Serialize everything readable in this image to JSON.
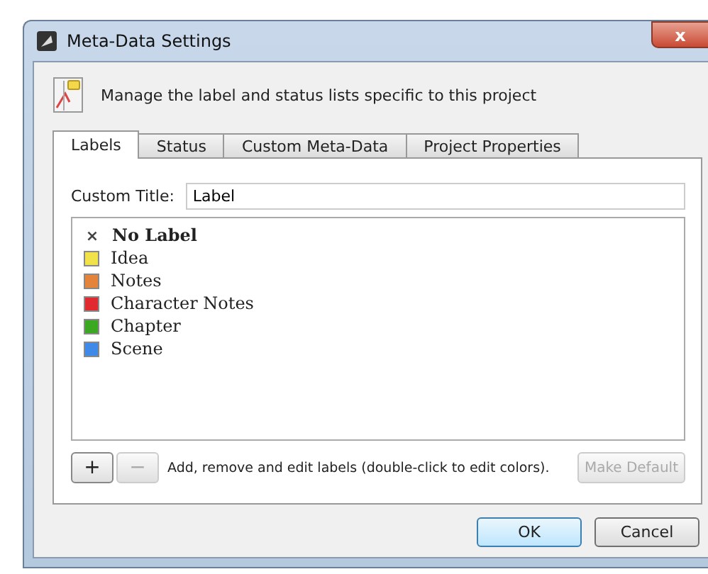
{
  "window": {
    "title": "Meta-Data Settings",
    "close": "x"
  },
  "header": {
    "text": "Manage the label and status lists specific to this project"
  },
  "tabs": [
    {
      "label": "Labels",
      "selected": true
    },
    {
      "label": "Status",
      "selected": false
    },
    {
      "label": "Custom Meta-Data",
      "selected": false
    },
    {
      "label": "Project Properties",
      "selected": false
    }
  ],
  "custom_title": {
    "label": "Custom Title:",
    "value": "Label"
  },
  "labels": [
    {
      "kind": "none",
      "name": "No Label",
      "mark": "×",
      "default": true
    },
    {
      "kind": "swatch",
      "name": "Idea",
      "color": "#f2e24a",
      "default": false
    },
    {
      "kind": "swatch",
      "name": "Notes",
      "color": "#e4843a",
      "default": false
    },
    {
      "kind": "swatch",
      "name": "Character Notes",
      "color": "#e02a30",
      "default": false
    },
    {
      "kind": "swatch",
      "name": "Chapter",
      "color": "#3aa820",
      "default": false
    },
    {
      "kind": "swatch",
      "name": "Scene",
      "color": "#3f8ae8",
      "default": false
    }
  ],
  "list_buttons": [
    {
      "label": "+",
      "disabled": false
    },
    {
      "label": "−",
      "disabled": true
    }
  ],
  "hint": "Add, remove and edit labels (double-click to edit colors).",
  "make_default": {
    "label": "Make Default",
    "disabled": true
  },
  "buttons": [
    {
      "label": "OK",
      "focused": true
    },
    {
      "label": "Cancel",
      "focused": false
    }
  ]
}
